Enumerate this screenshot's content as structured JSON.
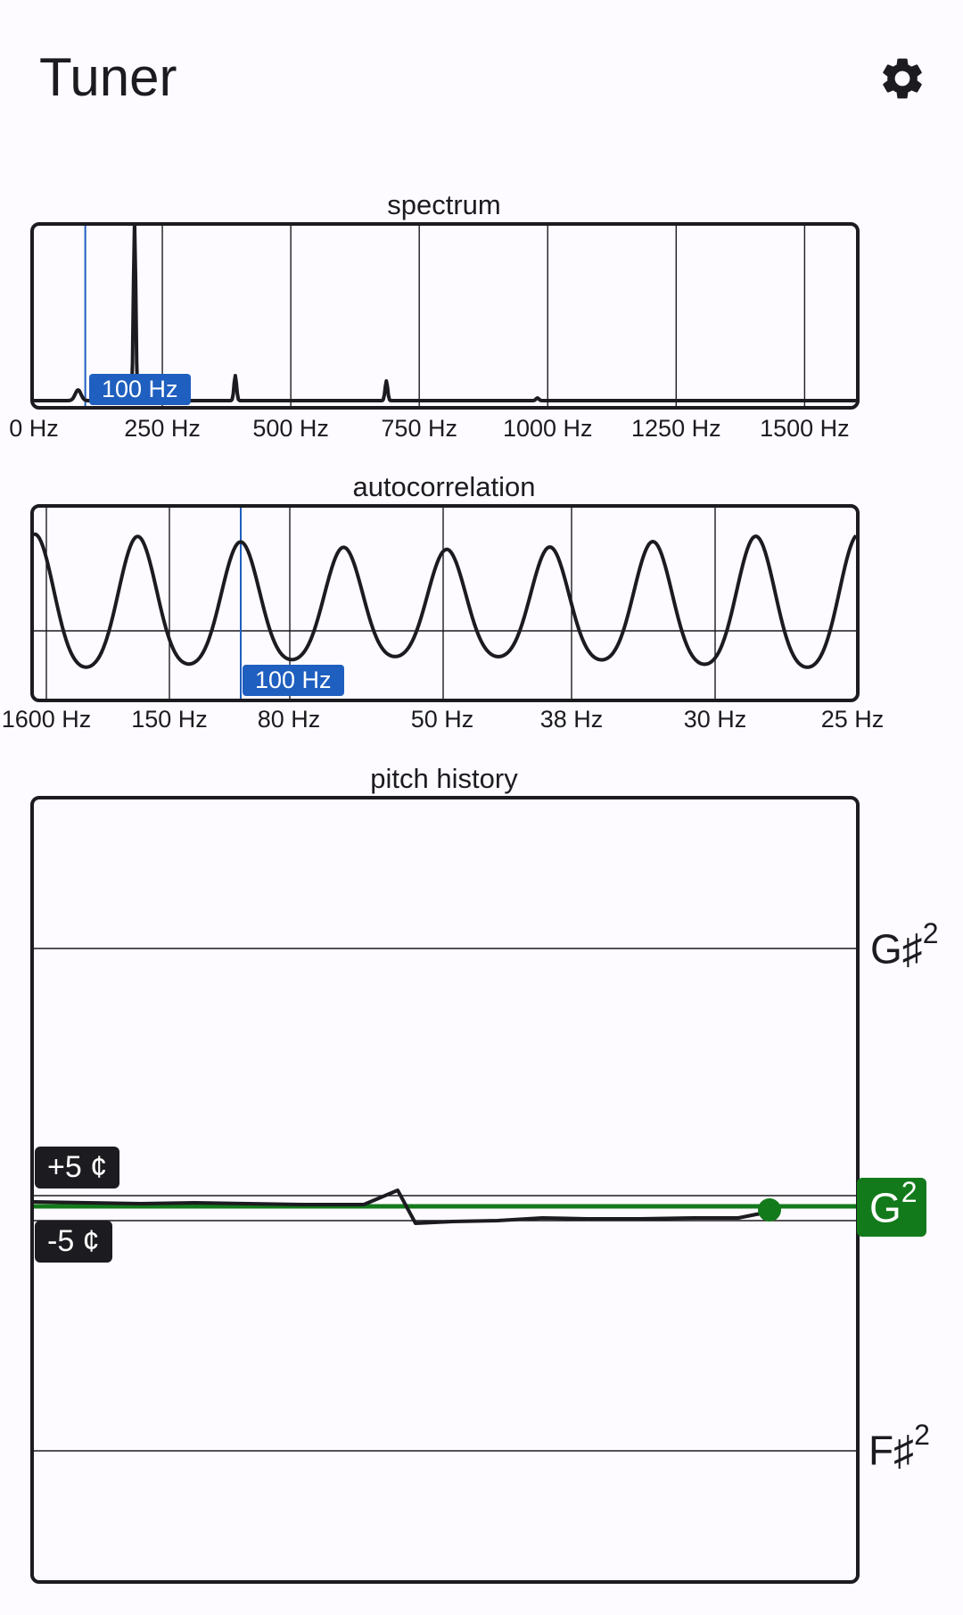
{
  "appbar": {
    "title": "Tuner",
    "settings_icon": "gear-icon"
  },
  "spectrum": {
    "title": "spectrum",
    "ticks": [
      "0 Hz",
      "250 Hz",
      "500 Hz",
      "750 Hz",
      "1000 Hz",
      "1250 Hz",
      "1500 Hz"
    ],
    "marker": "100 Hz"
  },
  "autocorrelation": {
    "title": "autocorrelation",
    "ticks": [
      "1600 Hz",
      "150 Hz",
      "80 Hz",
      "50 Hz",
      "38 Hz",
      "30 Hz",
      "25 Hz"
    ],
    "marker": "100 Hz"
  },
  "pitch_history": {
    "title": "pitch history",
    "plus_cents": "+5 ¢",
    "minus_cents": "-5 ¢",
    "note_above": {
      "name": "G♯",
      "octave": "2"
    },
    "note_current": {
      "name": "G",
      "octave": "2"
    },
    "note_below": {
      "name": "F♯",
      "octave": "2"
    },
    "current_color": "#137a1b"
  },
  "chart_data": [
    {
      "type": "line",
      "title": "spectrum",
      "xlabel": "",
      "ylabel": "",
      "x_ticks": [
        "0 Hz",
        "250 Hz",
        "500 Hz",
        "750 Hz",
        "1000 Hz",
        "1250 Hz",
        "1500 Hz"
      ],
      "xlim": [
        0,
        1600
      ],
      "marker_value": 100,
      "peaks_hz": [
        100,
        196,
        392,
        686
      ]
    },
    {
      "type": "line",
      "title": "autocorrelation",
      "x_ticks": [
        "1600 Hz",
        "150 Hz",
        "80 Hz",
        "50 Hz",
        "38 Hz",
        "30 Hz",
        "25 Hz"
      ],
      "marker_value": 100
    },
    {
      "type": "line",
      "title": "pitch history",
      "y_ticks": [
        "G♯2",
        "G2",
        "F♯2"
      ],
      "cents_band": [
        "+5 ¢",
        "-5 ¢"
      ],
      "current_note": "G2"
    }
  ]
}
